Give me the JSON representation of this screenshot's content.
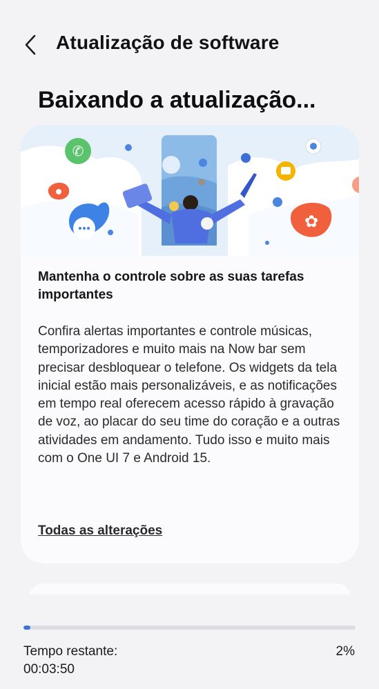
{
  "header": {
    "title": "Atualização de software",
    "back_icon": "chevron-left-icon"
  },
  "page_title": "Baixando a atualização...",
  "card": {
    "illustration": "one-ui-7-illustration",
    "heading": "Mantenha o controle sobre as suas tarefas importantes",
    "body": "Confira alertas importantes e controle músicas, temporizadores e muito mais na Now bar sem precisar desbloquear o telefone. Os widgets da tela inicial estão mais personalizáveis, e as notificações em tempo real oferecem acesso rápido à gravação de voz, ao placar do seu time do coração e a outras atividades em andamento. Tudo isso e muito mais com o One UI 7 e Android 15.",
    "link": "Todas as alterações"
  },
  "progress": {
    "value": 0.02,
    "percent_label": "2%",
    "time_label": "Tempo restante:",
    "time_value": "00:03:50",
    "accent": "#3e74d8",
    "track": "#dcdce2"
  }
}
